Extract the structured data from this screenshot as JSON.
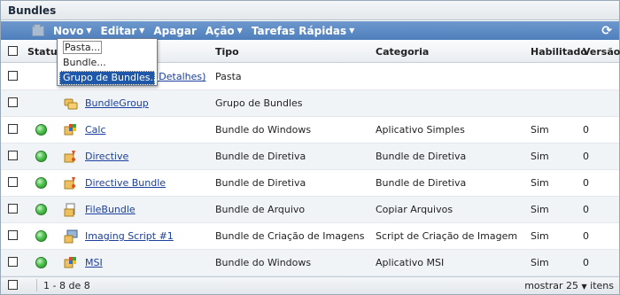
{
  "panel": {
    "title": "Bundles"
  },
  "toolbar": {
    "items": [
      {
        "label": "Novo",
        "has_caret": true
      },
      {
        "label": "Editar",
        "has_caret": true
      },
      {
        "label": "Apagar",
        "has_caret": false
      },
      {
        "label": "Ação",
        "has_caret": true
      },
      {
        "label": "Tarefas Rápidas",
        "has_caret": true
      }
    ],
    "refresh_icon": "refresh-icon"
  },
  "new_menu": {
    "items": [
      "Pasta...",
      "Bundle...",
      "Grupo de Bundles..."
    ],
    "highlighted_index": 2
  },
  "table": {
    "headers": {
      "status": "Status",
      "tipo": "Tipo",
      "categoria": "Categoria",
      "habilitado": "Habilitado",
      "versao": "Versão"
    },
    "rows": [
      {
        "name": "(Detalhes)",
        "tipo": "Pasta",
        "categoria": "",
        "habilitado": "",
        "versao": "",
        "status": false,
        "icon": "folder-icon"
      },
      {
        "name": "BundleGroup",
        "tipo": "Grupo de Bundles",
        "categoria": "",
        "habilitado": "",
        "versao": "",
        "status": false,
        "icon": "bundle-group-icon"
      },
      {
        "name": "Calc",
        "tipo": "Bundle do Windows",
        "categoria": "Aplicativo Simples",
        "habilitado": "Sim",
        "versao": "0",
        "status": true,
        "icon": "windows-bundle-icon"
      },
      {
        "name": "Directive",
        "tipo": "Bundle de Diretiva",
        "categoria": "Bundle de Diretiva",
        "habilitado": "Sim",
        "versao": "0",
        "status": true,
        "icon": "directive-bundle-icon"
      },
      {
        "name": "Directive Bundle",
        "tipo": "Bundle de Diretiva",
        "categoria": "Bundle de Diretiva",
        "habilitado": "Sim",
        "versao": "0",
        "status": true,
        "icon": "directive-bundle-icon"
      },
      {
        "name": "FileBundle",
        "tipo": "Bundle de Arquivo",
        "categoria": "Copiar Arquivos",
        "habilitado": "Sim",
        "versao": "0",
        "status": true,
        "icon": "file-bundle-icon"
      },
      {
        "name": "Imaging Script #1",
        "tipo": "Bundle de Criação de Imagens",
        "categoria": "Script de Criação de Imagem",
        "habilitado": "Sim",
        "versao": "0",
        "status": true,
        "icon": "imaging-bundle-icon"
      },
      {
        "name": "MSI",
        "tipo": "Bundle do Windows",
        "categoria": "Aplicativo MSI",
        "habilitado": "Sim",
        "versao": "0",
        "status": true,
        "icon": "windows-bundle-icon"
      }
    ]
  },
  "footer": {
    "range": "1 - 8 de 8",
    "show_label": "mostrar",
    "page_size": "25",
    "items_label": "itens"
  },
  "colors": {
    "toolbar": "#5a88c3",
    "link": "#1a3f9c",
    "menu_highlight": "#1f58a8",
    "status_green": "#4fc24f"
  }
}
